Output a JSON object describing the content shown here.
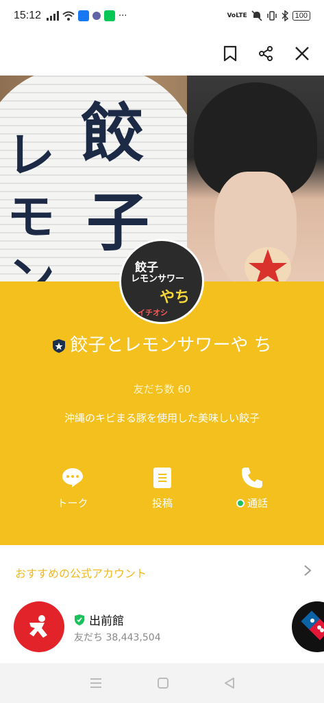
{
  "status_bar": {
    "time": "15:12",
    "battery": "100",
    "volte": "VoLTE"
  },
  "toolbar": {
    "icons": [
      "bookmark-icon",
      "share-icon",
      "close-icon"
    ]
  },
  "cover": {
    "lantern_text_1": "餃",
    "lantern_text_2": "子",
    "lantern_text_3": "レ",
    "lantern_text_4": "モ",
    "lantern_text_5": "ン"
  },
  "avatar": {
    "line1": "餃子",
    "line2": "レモンサワー",
    "line3": "やち",
    "line4": "イチオシ"
  },
  "profile": {
    "name": "餃子とレモンサワーや ち",
    "friends": "友だち数 60",
    "description": "沖縄のキビまる豚を使用した美味しい餃子",
    "accent_color": "#f4c01e"
  },
  "actions": [
    {
      "label": "トーク",
      "icon": "chat-bubble-icon"
    },
    {
      "label": "投稿",
      "icon": "post-icon"
    },
    {
      "label": "通話",
      "icon": "phone-icon"
    }
  ],
  "recommended": {
    "title": "おすすめの公式アカウント",
    "items": [
      {
        "name": "出前館",
        "friends": "友だち 38,443,504"
      }
    ]
  }
}
